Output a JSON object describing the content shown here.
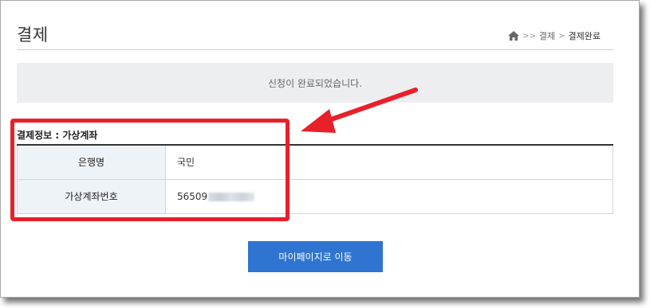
{
  "page": {
    "title": "결제",
    "breadcrumb": {
      "home_icon": "home-icon",
      "sep1": ">>",
      "item1": "결제",
      "sep2": ">",
      "item2": "결제완료"
    }
  },
  "notice": {
    "text": "신청이 완료되었습니다."
  },
  "payment_info": {
    "title": "결제정보 : 가상계좌",
    "rows": [
      {
        "label": "은행명",
        "value": "국민"
      },
      {
        "label": "가상계좌번호",
        "value": "56509"
      }
    ]
  },
  "actions": {
    "mypage_button": "마이페이지로 이동"
  },
  "colors": {
    "accent": "#2f74d0",
    "highlight": "#e8202a",
    "notice_bg": "#edeef0",
    "table_header_bg": "#eef3f8"
  }
}
